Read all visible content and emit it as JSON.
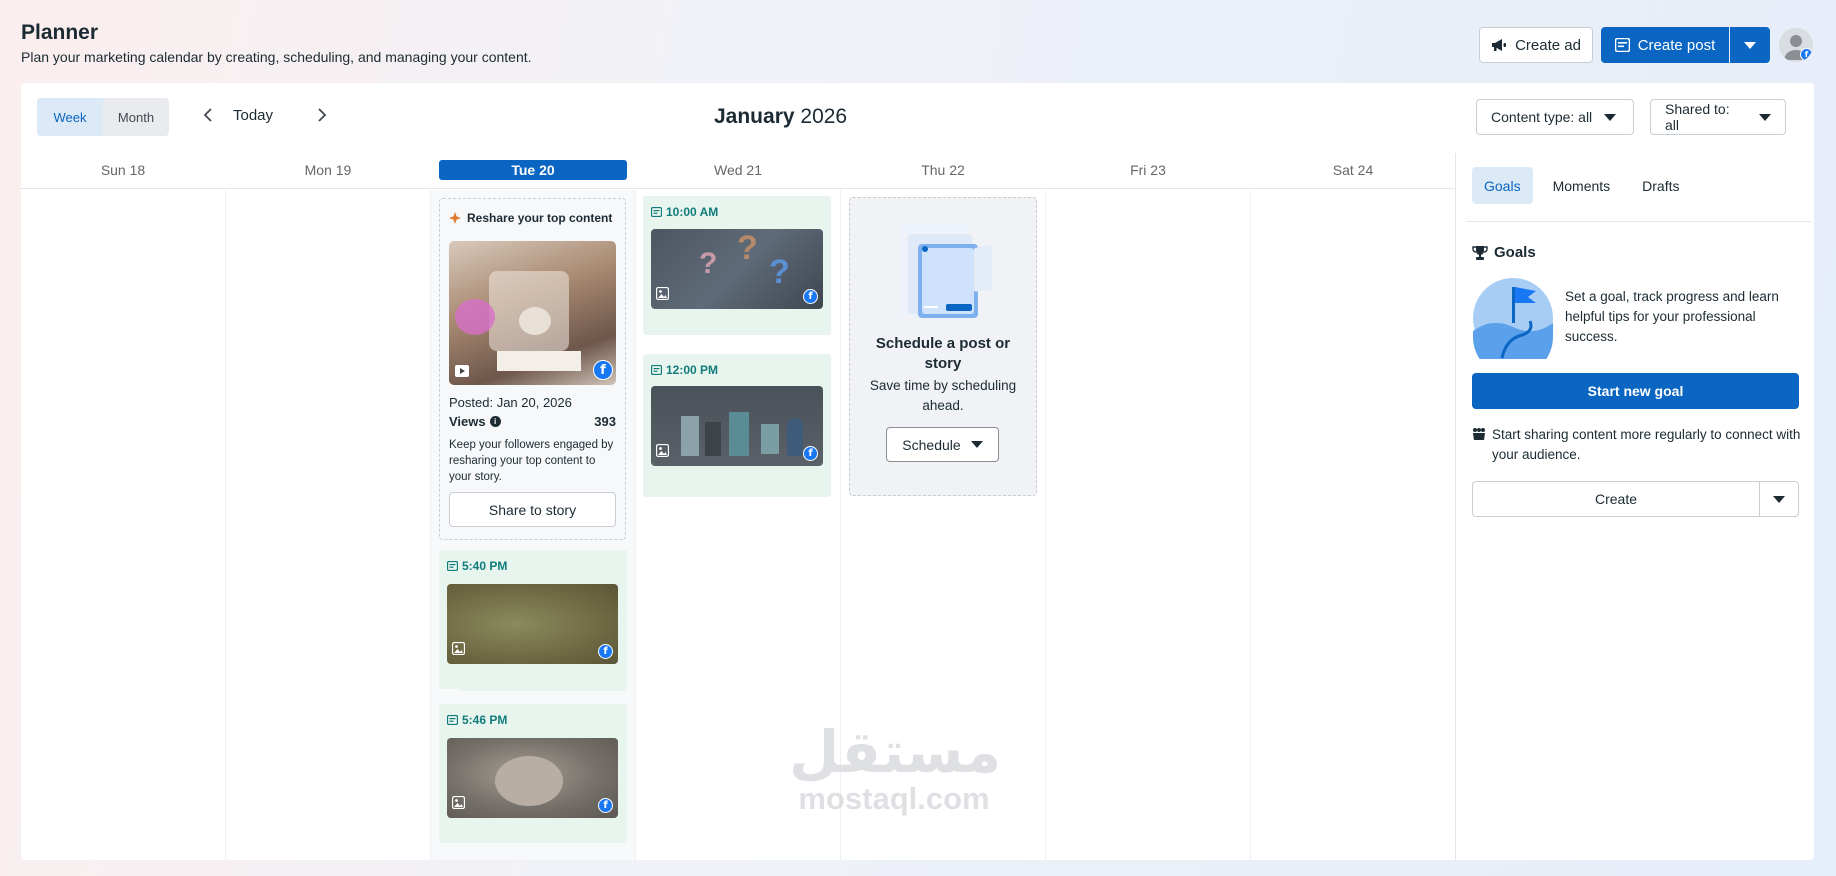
{
  "header": {
    "title": "Planner",
    "subtitle": "Plan your marketing calendar by creating, scheduling, and managing your content."
  },
  "actions": {
    "create_ad": "Create ad",
    "create_post": "Create post"
  },
  "toolbar": {
    "view_week": "Week",
    "view_month": "Month",
    "today": "Today",
    "month_title": "January",
    "year_title": "2026",
    "content_type": "Content type: all",
    "shared_to": "Shared to: all"
  },
  "days": [
    {
      "label": "Sun 18"
    },
    {
      "label": "Mon 19"
    },
    {
      "label": "Tue 20"
    },
    {
      "label": "Wed 21"
    },
    {
      "label": "Thu 22"
    },
    {
      "label": "Fri 23"
    },
    {
      "label": "Sat 24"
    }
  ],
  "reshare": {
    "title": "Reshare your top content",
    "posted": "Posted: Jan 20, 2026",
    "views_label": "Views",
    "views_value": "393",
    "desc": "Keep your followers engaged by resharing your top content to your story.",
    "button": "Share to story"
  },
  "posts": {
    "tue_1": "5:40 PM",
    "tue_2": "5:46 PM",
    "wed_1": "10:00 AM",
    "wed_2": "12:00 PM"
  },
  "schedule_card": {
    "title": "Schedule a post or story",
    "desc": "Save time by scheduling ahead.",
    "button": "Schedule"
  },
  "sidebar": {
    "tabs": [
      "Goals",
      "Moments",
      "Drafts"
    ],
    "goals_title": "Goals",
    "goals_desc": "Set a goal, track progress and learn helpful tips for your professional success.",
    "start_goal": "Start new goal",
    "tip": "Start sharing content more regularly to connect with your audience.",
    "create": "Create"
  },
  "watermark": {
    "arabic": "مستقل",
    "latin": "mostaql.com"
  },
  "colors": {
    "primary": "#0a66c2",
    "post_bg": "#e8f4ee",
    "time_teal": "#0f7c7a"
  }
}
